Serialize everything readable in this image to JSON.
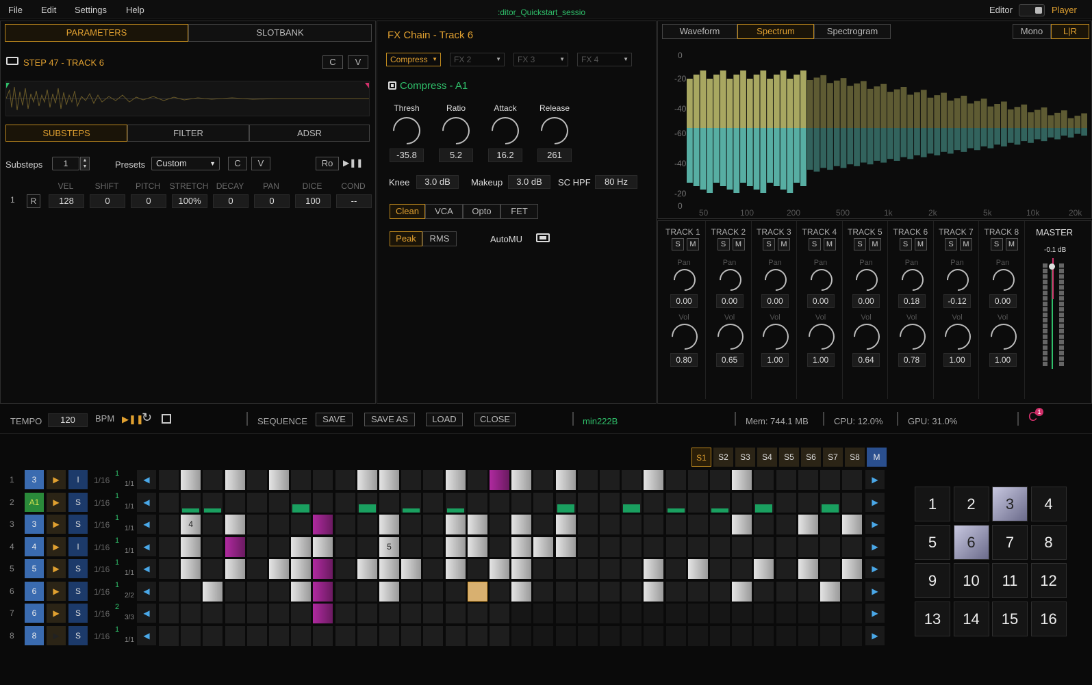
{
  "menu": [
    "File",
    "Edit",
    "Settings",
    "Help"
  ],
  "session_title": ":ditor_Quickstart_sessio",
  "mode": {
    "editor": "Editor",
    "player": "Player"
  },
  "left": {
    "tabs": [
      "PARAMETERS",
      "SLOTBANK"
    ],
    "step_title": "STEP 47 - TRACK 6",
    "c": "C",
    "v": "V",
    "subtabs": [
      "SUBSTEPS",
      "FILTER",
      "ADSR"
    ],
    "substeps_label": "Substeps",
    "substeps_value": "1",
    "presets_label": "Presets",
    "presets_value": "Custom",
    "ro": "Ro",
    "columns": [
      "VEL",
      "SHIFT",
      "PITCH",
      "STRETCH",
      "DECAY",
      "PAN",
      "DICE",
      "COND"
    ],
    "row_index": "1",
    "r": "R",
    "row_values": [
      "128",
      "0",
      "0",
      "100%",
      "0",
      "0",
      "100",
      "--"
    ]
  },
  "fx": {
    "title": "FX Chain - Track 6",
    "slots": [
      "Compress",
      "FX 2",
      "FX 3",
      "FX 4"
    ],
    "plugin": "Compress - A1",
    "knobs": [
      {
        "label": "Thresh",
        "value": "-35.8"
      },
      {
        "label": "Ratio",
        "value": "5.2"
      },
      {
        "label": "Attack",
        "value": "16.2"
      },
      {
        "label": "Release",
        "value": "261"
      }
    ],
    "knee_label": "Knee",
    "knee": "3.0 dB",
    "makeup_label": "Makeup",
    "makeup": "3.0 dB",
    "schpf_label": "SC HPF",
    "schpf": "80 Hz",
    "modes": [
      "Clean",
      "VCA",
      "Opto",
      "FET"
    ],
    "detect": [
      "Peak",
      "RMS"
    ],
    "automu": "AutoMU"
  },
  "spectrum": {
    "tabs": [
      "Waveform",
      "Spectrum",
      "Spectrogram"
    ],
    "ch": [
      "Mono",
      "L|R"
    ],
    "ylabels": [
      "0",
      "-20",
      "-40",
      "-60",
      "-40",
      "-20",
      "0"
    ],
    "xlabels": [
      "50",
      "100",
      "200",
      "500",
      "1k",
      "2k",
      "5k",
      "10k",
      "20k"
    ]
  },
  "mixer": {
    "tracks": [
      {
        "name": "TRACK 1",
        "pan": "0.00",
        "vol": "0.80"
      },
      {
        "name": "TRACK 2",
        "pan": "0.00",
        "vol": "0.65"
      },
      {
        "name": "TRACK 3",
        "pan": "0.00",
        "vol": "1.00"
      },
      {
        "name": "TRACK 4",
        "pan": "0.00",
        "vol": "1.00"
      },
      {
        "name": "TRACK 5",
        "pan": "0.00",
        "vol": "0.64"
      },
      {
        "name": "TRACK 6",
        "pan": "0.18",
        "vol": "0.78"
      },
      {
        "name": "TRACK 7",
        "pan": "-0.12",
        "vol": "1.00"
      },
      {
        "name": "TRACK 8",
        "pan": "0.00",
        "vol": "1.00"
      }
    ],
    "s": "S",
    "m": "M",
    "pan_label": "Pan",
    "vol_label": "Vol",
    "master": "MASTER",
    "master_db": "-0.1 dB"
  },
  "transport": {
    "tempo_label": "TEMPO",
    "tempo": "120",
    "bpm": "BPM",
    "sequence": "SEQUENCE",
    "save": "SAVE",
    "save_as": "SAVE AS",
    "load": "LOAD",
    "close": "CLOSE",
    "seq_name": "min222B",
    "mem": "Mem: 744.1 MB",
    "cpu": "CPU: 12.0%",
    "gpu": "GPU: 31.0%",
    "badge": "1"
  },
  "scenes": [
    "S1",
    "S2",
    "S3",
    "S4",
    "S5",
    "S6",
    "S7",
    "S8",
    "M"
  ],
  "rows": [
    {
      "n": "1",
      "id": "3",
      "mode": "I",
      "div": "1/16",
      "top": "1",
      "bot": "1/1"
    },
    {
      "n": "2",
      "id": "A1",
      "mode": "S",
      "div": "1/16",
      "top": "1",
      "bot": "1/1"
    },
    {
      "n": "3",
      "id": "3",
      "mode": "S",
      "div": "1/16",
      "top": "1",
      "bot": "1/1"
    },
    {
      "n": "4",
      "id": "4",
      "mode": "I",
      "div": "1/16",
      "top": "1",
      "bot": "1/1"
    },
    {
      "n": "5",
      "id": "5",
      "mode": "S",
      "div": "1/16",
      "top": "1",
      "bot": "1/1"
    },
    {
      "n": "6",
      "id": "6",
      "mode": "S",
      "div": "1/16",
      "top": "1",
      "bot": "2/2"
    },
    {
      "n": "7",
      "id": "6",
      "mode": "S",
      "div": "1/16",
      "top": "2",
      "bot": "3/3"
    },
    {
      "n": "8",
      "id": "8",
      "mode": "S",
      "div": "1/16",
      "top": "1",
      "bot": "1/1"
    }
  ],
  "cell_labels": {
    "r3": "4",
    "r4": "5"
  },
  "pads": [
    "1",
    "2",
    "3",
    "4",
    "5",
    "6",
    "7",
    "8",
    "9",
    "10",
    "11",
    "12",
    "13",
    "14",
    "15",
    "16"
  ],
  "colors": {
    "accent": "#e0a030",
    "green": "#2fbf6a",
    "purple": "#9a2a8a",
    "blue": "#3a6bb0"
  }
}
